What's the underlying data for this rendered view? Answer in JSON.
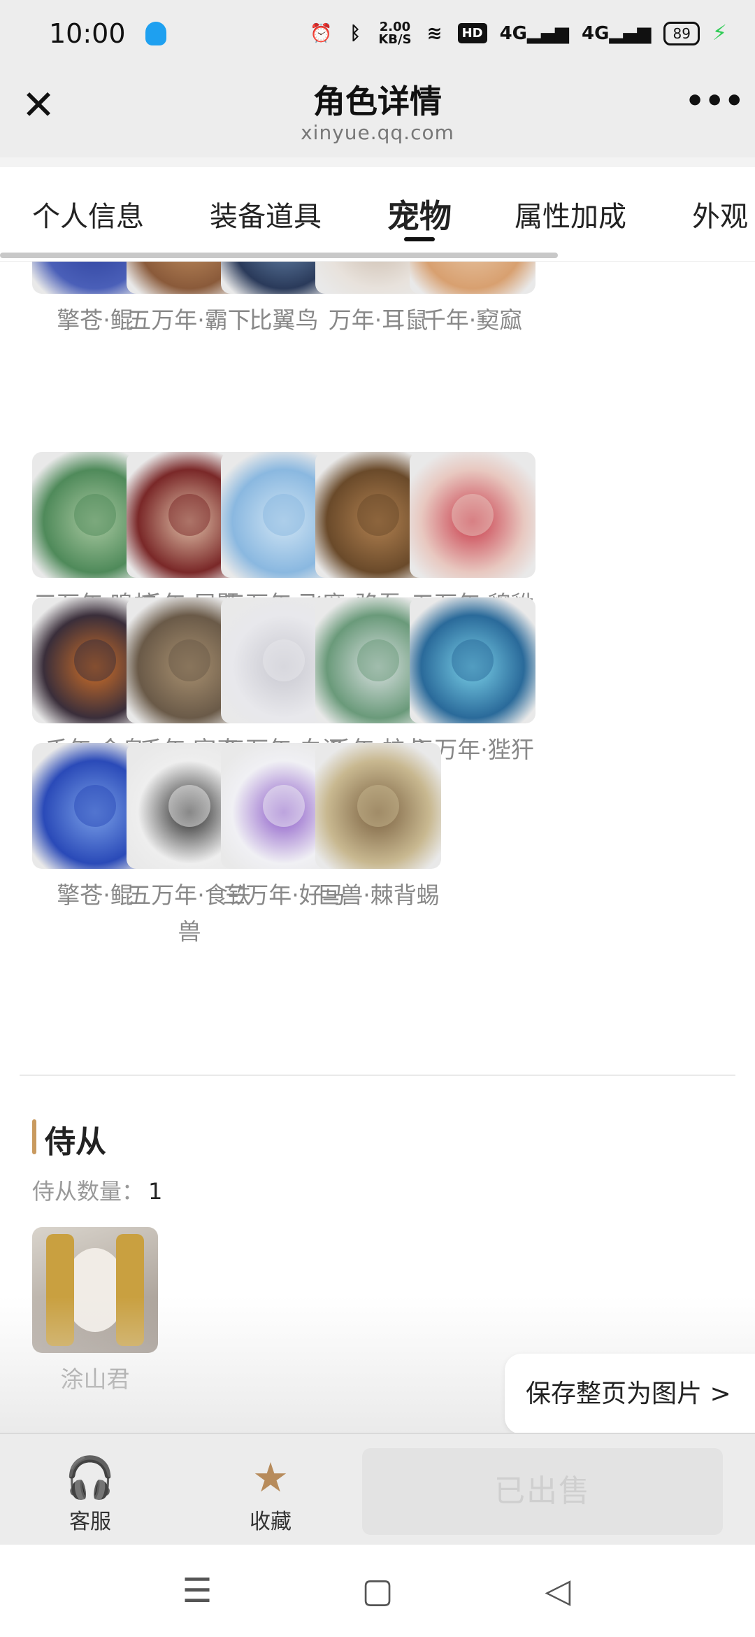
{
  "status_bar": {
    "time": "10:00",
    "speed_value": "2.00",
    "speed_unit": "KB/S",
    "hd_label": "HD",
    "net1": "4G",
    "net2": "4G",
    "battery": "89"
  },
  "header": {
    "title": "角色详情",
    "subtitle": "xinyue.qq.com",
    "close_icon": "close-icon",
    "more_icon": "more-icon"
  },
  "tabs": [
    {
      "label": "个人信息",
      "active": false
    },
    {
      "label": "装备道具",
      "active": false
    },
    {
      "label": "宠物",
      "active": true
    },
    {
      "label": "属性加成",
      "active": false
    },
    {
      "label": "外观",
      "active": false
    }
  ],
  "pets": [
    {
      "name": "擎苍·鲲"
    },
    {
      "name": "五万年·霸下"
    },
    {
      "name": "比翼鸟"
    },
    {
      "name": "万年·耳鼠"
    },
    {
      "name": "千年·窫窳"
    },
    {
      "name": "三万年·鸣蛇"
    },
    {
      "name": "千年·居暨"
    },
    {
      "name": "五万年·飞廉"
    },
    {
      "name": "驺吾"
    },
    {
      "name": "五万年·貔貅"
    },
    {
      "name": "千年·金乌"
    },
    {
      "name": "千年·穷奇"
    },
    {
      "name": "五万年·白泽"
    },
    {
      "name": "千年·蛟龙"
    },
    {
      "name": "五万年·狴犴"
    },
    {
      "name": "擎苍·鲲"
    },
    {
      "name": "五万年·食铁兽"
    },
    {
      "name": "三万年·好马"
    },
    {
      "name": "巨兽·棘背蜴"
    }
  ],
  "servants": {
    "title": "侍从",
    "count_label": "侍从数量：",
    "count": "1",
    "items": [
      {
        "name": "涂山君"
      }
    ]
  },
  "save_button": "保存整页为图片 >",
  "bottom_bar": {
    "service_label": "客服",
    "favorite_label": "收藏",
    "sold_label": "已出售"
  },
  "colors": {
    "accent": "#c99a5f",
    "favorite_star": "#b78b5b",
    "charging": "#2fcc55"
  }
}
